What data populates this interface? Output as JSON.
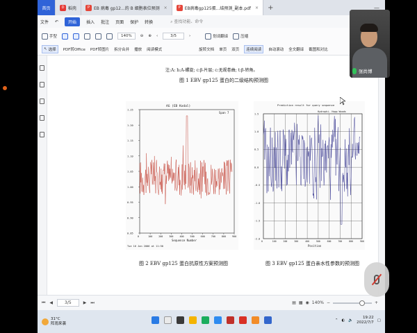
{
  "tabs": {
    "home": "首页",
    "t1": "稻壳",
    "t2": "EB 病毒 gp12...的 B 细胞表位预测",
    "t3": "EB病毒gp125蛋...结预测_副本.pdf"
  },
  "menu": {
    "file": "文件",
    "open": "开始",
    "items": [
      "插入",
      "批注",
      "页面",
      "保护",
      "转换"
    ],
    "search": "查找功能、命令",
    "share": "分享"
  },
  "toolbar": {
    "hand": "手型",
    "select": "选择",
    "pdf_office": "PDF转Office",
    "pdf_img": "PDF转图片",
    "split": "拆分合并",
    "play": "播放",
    "read": "阅读模式",
    "zoom": "140%",
    "page": "3/5",
    "rotate": "旋转文档",
    "single": "单页",
    "double": "双页",
    "continuous": "连续阅读",
    "autoscroll": "自动滚动",
    "translate_word": "划词翻译",
    "translate_all": "全文翻译",
    "compress": "压缩",
    "screenshot": "截图和对比",
    "text_compare": "文档比较"
  },
  "document": {
    "note": "注:A: h:A-螺旋; c:β-片层; c:无规卷曲; t:β-转角。",
    "fig1_caption": "图 1  EBV gp125 蛋白的二级结构预测图",
    "fig2_caption": "图 2  EBV gp125 蛋白抗原性方案预测图",
    "fig3_caption": "图 3  EBV gp125 蛋白亲水性参数的预测图",
    "fig2_title": "AG    (EB Kodal)",
    "fig2_span": "Span 7",
    "fig2_xlabel": "Sequence Number",
    "fig2_footer": "Tue 16 Jan 2006 at 11:50",
    "fig3_title": "Prediction result for query sequence",
    "fig3_legend": "Hydrophi.   Hopp   Woods",
    "fig3_xlabel": "Position"
  },
  "chart_data": [
    {
      "type": "line",
      "title": "AG    (EB Kodal)",
      "xlabel": "Sequence Number",
      "ylabel": "",
      "xlim": [
        0,
        900
      ],
      "ylim": [
        0.85,
        1.25
      ],
      "xticks": [
        0,
        100,
        200,
        300,
        400,
        500,
        600,
        700,
        800,
        900
      ],
      "yticks": [
        0.85,
        0.9,
        0.95,
        1.0,
        1.05,
        1.1,
        1.15,
        1.2,
        1.25
      ],
      "color": "#c0392b",
      "grid": false
    },
    {
      "type": "line",
      "title": "Prediction result for query sequence",
      "xlabel": "Position",
      "ylabel": "",
      "xlim": [
        0,
        900
      ],
      "ylim": [
        -2.0,
        1.5
      ],
      "xticks": [
        0,
        100,
        200,
        300,
        400,
        500,
        600,
        700,
        800,
        900
      ],
      "yticks": [
        -2.0,
        -1.5,
        -1.0,
        -0.5,
        0.0,
        0.5,
        1.0,
        1.5
      ],
      "color": "#2d2d8a",
      "grid": true
    }
  ],
  "status": {
    "page": "3/5",
    "zoom": "140%"
  },
  "taskbar": {
    "temp": "31°C",
    "weather": "阵雨来袭",
    "time": "19:22",
    "date": "2022/7/7"
  },
  "webcam": {
    "name": "张尚博"
  }
}
